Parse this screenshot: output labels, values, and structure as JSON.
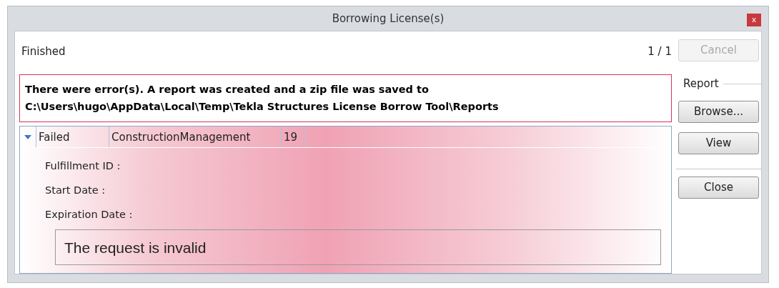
{
  "window": {
    "title": "Borrowing License(s)",
    "close": "x"
  },
  "status": {
    "text": "Finished",
    "progress": "1 / 1"
  },
  "cancel_button": {
    "label": "Cancel",
    "disabled": true
  },
  "error_message": "There were error(s). A report was created and a zip file was saved to\nC:\\Users\\hugo\\AppData\\Local\\Temp\\Tekla Structures License Borrow Tool\\Reports",
  "report_group": {
    "title": "Report",
    "buttons": [
      {
        "label": "Browse...",
        "disabled": false
      },
      {
        "label": "View",
        "disabled": false
      }
    ]
  },
  "close_button": {
    "label": "Close"
  },
  "results": [
    {
      "expanded": true,
      "status": "Failed",
      "product": "ConstructionManagement",
      "version": "19",
      "details": [
        "Fulfillment ID :",
        "Start Date :",
        "Expiration Date :"
      ],
      "message": "The request is invalid"
    }
  ]
}
